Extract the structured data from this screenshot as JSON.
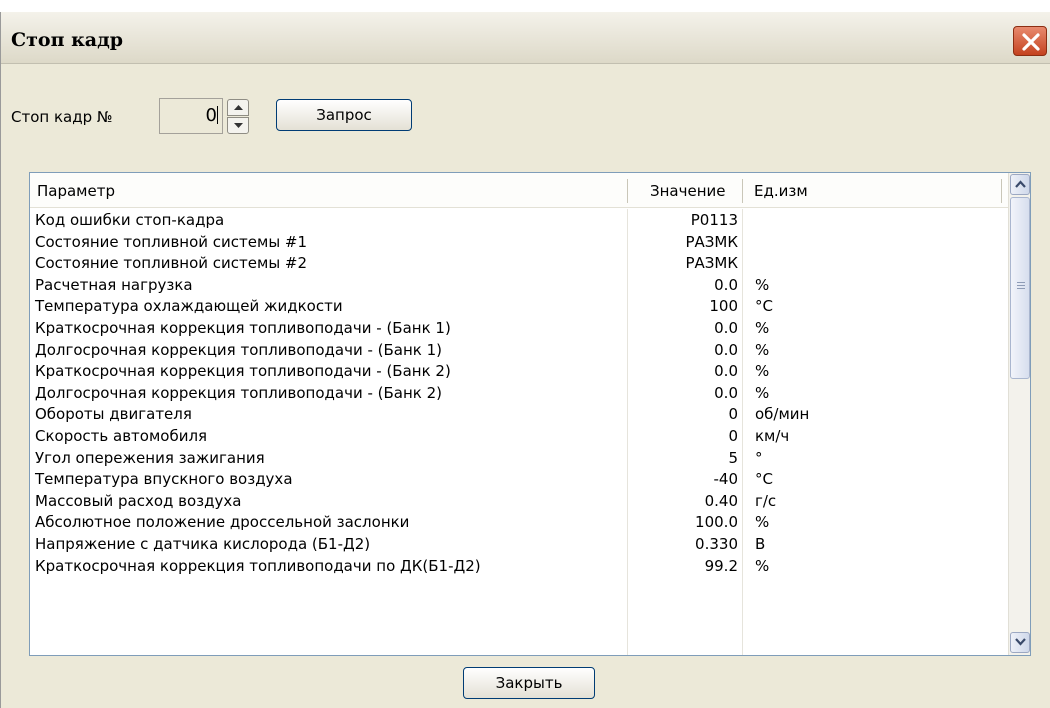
{
  "window": {
    "title": "Стоп кадр"
  },
  "frame": {
    "label": "Стоп кадр №",
    "value": "0"
  },
  "buttons": {
    "query": "Запрос",
    "close": "Закрыть"
  },
  "table": {
    "columns": [
      "Параметр",
      "Значение",
      "Ед.изм"
    ],
    "rows": [
      {
        "param": "Код ошибки стоп-кадра",
        "value": "P0113",
        "unit": ""
      },
      {
        "param": "Состояние топливной системы #1",
        "value": "РАЗМК",
        "unit": ""
      },
      {
        "param": "Состояние топливной системы #2",
        "value": "РАЗМК",
        "unit": ""
      },
      {
        "param": "Расчетная нагрузка",
        "value": "0.0",
        "unit": "%"
      },
      {
        "param": "Температура охлаждающей жидкости",
        "value": "100",
        "unit": "°С"
      },
      {
        "param": "Краткосрочная коррекция топливоподачи - (Банк 1)",
        "value": "0.0",
        "unit": "%"
      },
      {
        "param": "Долгосрочная коррекция топливоподачи -  (Банк 1)",
        "value": "0.0",
        "unit": "%"
      },
      {
        "param": "Краткосрочная коррекция топливоподачи - (Банк 2)",
        "value": "0.0",
        "unit": "%"
      },
      {
        "param": "Долгосрочная коррекция топливоподачи -  (Банк 2)",
        "value": "0.0",
        "unit": "%"
      },
      {
        "param": "Обороты двигателя",
        "value": "0",
        "unit": "об/мин"
      },
      {
        "param": "Скорость автомобиля",
        "value": "0",
        "unit": "км/ч"
      },
      {
        "param": "Угол опережения зажигания",
        "value": "5",
        "unit": "°"
      },
      {
        "param": "Температура впускного воздуха",
        "value": "-40",
        "unit": "°С"
      },
      {
        "param": "Массовый расход воздуха",
        "value": "0.40",
        "unit": "г/с"
      },
      {
        "param": "Абсолютное положение дроссельной заслонки",
        "value": "100.0",
        "unit": "%"
      },
      {
        "param": "Напряжение с датчика кислорода (Б1-Д2)",
        "value": "0.330",
        "unit": "В"
      },
      {
        "param": "Краткосрочная коррекция топливоподачи по ДК(Б1-Д2)",
        "value": "99.2",
        "unit": "%"
      }
    ]
  }
}
